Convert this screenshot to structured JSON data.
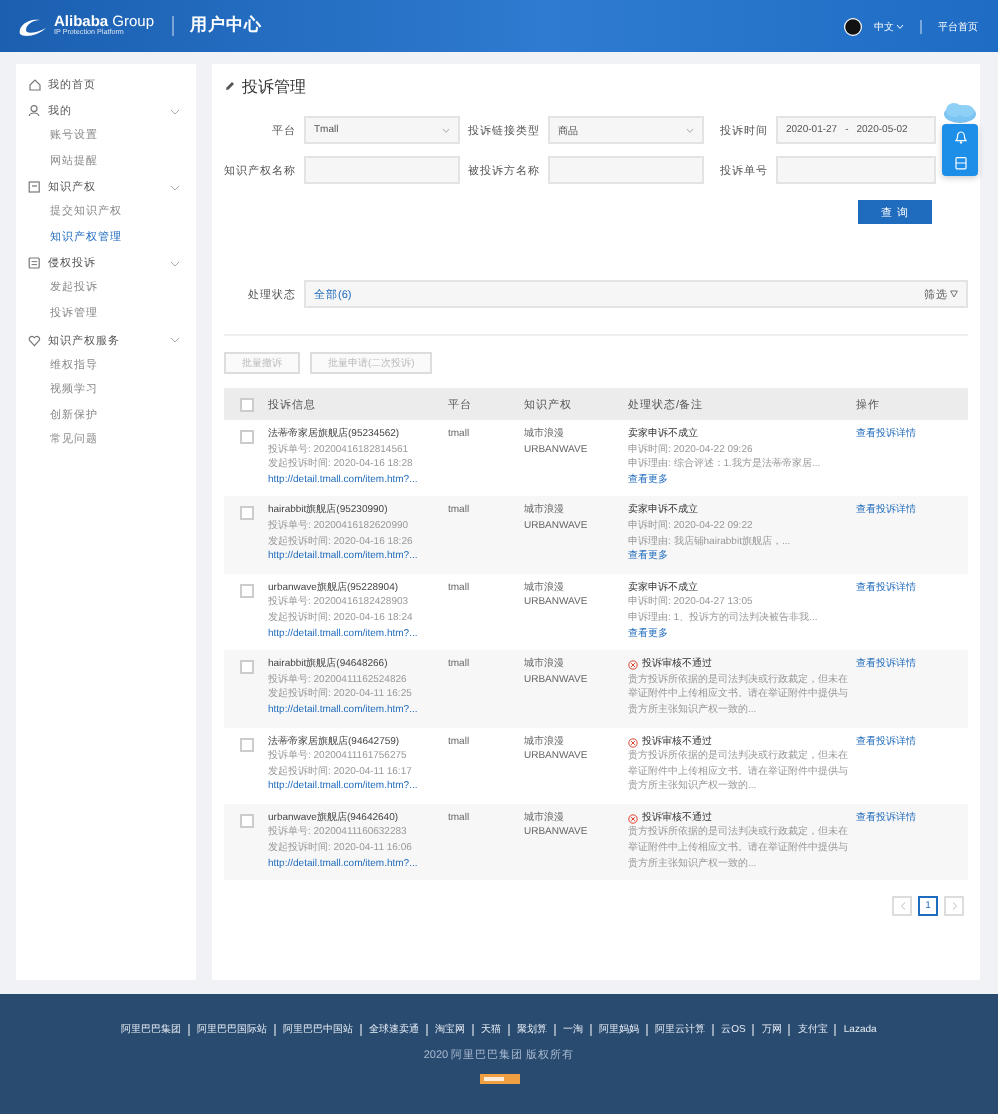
{
  "header": {
    "logo_name": "**Alibaba** Group",
    "logo_subtitle": "IP Protection Platform",
    "title": "用户中心",
    "language": "中文",
    "home_link": "平台首页"
  },
  "sidebar": {
    "items": [
      {
        "label": "我的首页",
        "kind": "link",
        "selected": false
      },
      {
        "label": "我的",
        "kind": "group",
        "expanded": true,
        "children": [
          {
            "label": "账号设置",
            "selected": false
          },
          {
            "label": "网站提醒",
            "selected": false
          }
        ]
      },
      {
        "label": "知识产权",
        "kind": "group",
        "expanded": true,
        "children": [
          {
            "label": "提交知识产权",
            "selected": false
          },
          {
            "label": "知识产权管理",
            "selected": true
          }
        ]
      },
      {
        "label": "侵权投诉",
        "kind": "group",
        "expanded": true,
        "children": [
          {
            "label": "发起投诉",
            "selected": false
          },
          {
            "label": "投诉管理",
            "selected": false
          }
        ]
      },
      {
        "label": "知识产权服务",
        "kind": "group",
        "expanded": true,
        "children": [
          {
            "label": "维权指导",
            "selected": false
          },
          {
            "label": "视频学习",
            "selected": false
          },
          {
            "label": "创新保护",
            "selected": false
          },
          {
            "label": "常见问题",
            "selected": false
          }
        ]
      }
    ]
  },
  "page_title": "投诉管理",
  "filters": [
    {
      "label": "平台",
      "kind": "select",
      "value": "Tmall"
    },
    {
      "label": "投诉链接类型",
      "kind": "select",
      "value": "商品"
    },
    {
      "label": "投诉时间",
      "kind": "daterange",
      "start": "2020-01-27",
      "separator": "-",
      "end": "2020-05-02"
    },
    {
      "label": "知识产权名称",
      "kind": "text"
    },
    {
      "label": "被投诉方名称",
      "kind": "text"
    },
    {
      "label": "投诉单号",
      "kind": "text"
    }
  ],
  "search_button": "查 询",
  "status_filter": {
    "label": "处理状态",
    "options": [
      {
        "label": "全部(6)",
        "selected": true
      }
    ],
    "filter_button": "筛选"
  },
  "bulk_actions": [
    {
      "label": "批量撤诉",
      "disabled": true
    },
    {
      "label": "批量申请(二次投诉)",
      "disabled": true
    }
  ],
  "table": {
    "all_checked": false,
    "columns": [
      "投诉信息",
      "平台",
      "知识产权",
      "处理状态/备注",
      "操作"
    ],
    "rows": [
      {
        "checked": false,
        "store": "法蒂帝家居旗舰店(95234562)",
        "complaint_no": "投诉单号: 20200416182814561",
        "filed_time": "发起投诉时间: 2020-04-16 18:28",
        "link": "http://detail.tmall.com/item.htm?...",
        "platform": "tmall",
        "ip_name": "城市浪漫",
        "ip_brand": "URBANWAVE",
        "status": {
          "kind": "appeal",
          "title": "卖家申诉不成立",
          "time": "申诉时间: 2020-04-22 09:26",
          "reason": "申诉理由: 综合评述：1.我方是法蒂帝家居...",
          "more": "查看更多"
        },
        "action": "查看投诉详情"
      },
      {
        "checked": false,
        "store": "hairabbit旗舰店(95230990)",
        "complaint_no": "投诉单号: 20200416182620990",
        "filed_time": "发起投诉时间: 2020-04-16 18:26",
        "link": "http://detail.tmall.com/item.htm?...",
        "platform": "tmall",
        "ip_name": "城市浪漫",
        "ip_brand": "URBANWAVE",
        "status": {
          "kind": "appeal",
          "title": "卖家申诉不成立",
          "time": "申诉时间: 2020-04-22 09:22",
          "reason": "申诉理由: 我店铺hairabbit旗舰店，...",
          "more": "查看更多"
        },
        "action": "查看投诉详情"
      },
      {
        "checked": false,
        "store": "urbanwave旗舰店(95228904)",
        "complaint_no": "投诉单号: 20200416182428903",
        "filed_time": "发起投诉时间: 2020-04-16 18:24",
        "link": "http://detail.tmall.com/item.htm?...",
        "platform": "tmall",
        "ip_name": "城市浪漫",
        "ip_brand": "URBANWAVE",
        "status": {
          "kind": "appeal",
          "title": "卖家申诉不成立",
          "time": "申诉时间: 2020-04-27 13:05",
          "reason": "申诉理由: 1、投诉方的司法判决被告非我...",
          "more": "查看更多"
        },
        "action": "查看投诉详情"
      },
      {
        "checked": false,
        "store": "hairabbit旗舰店(94648266)",
        "complaint_no": "投诉单号: 20200411162524826",
        "filed_time": "发起投诉时间: 2020-04-11 16:25",
        "link": "http://detail.tmall.com/item.htm?...",
        "platform": "tmall",
        "ip_name": "城市浪漫",
        "ip_brand": "URBANWAVE",
        "status": {
          "kind": "rejected",
          "title": "投诉审核不通过",
          "note": "贵方投诉所依据的是司法判决或行政裁定，但未在举证附件中上传相应文书。请在举证附件中提供与贵方所主张知识产权一致的..."
        },
        "action": "查看投诉详情"
      },
      {
        "checked": false,
        "store": "法蒂帝家居旗舰店(94642759)",
        "complaint_no": "投诉单号: 20200411161756275",
        "filed_time": "发起投诉时间: 2020-04-11 16:17",
        "link": "http://detail.tmall.com/item.htm?...",
        "platform": "tmall",
        "ip_name": "城市浪漫",
        "ip_brand": "URBANWAVE",
        "status": {
          "kind": "rejected",
          "title": "投诉审核不通过",
          "note": "贵方投诉所依据的是司法判决或行政裁定，但未在举证附件中上传相应文书。请在举证附件中提供与贵方所主张知识产权一致的..."
        },
        "action": "查看投诉详情"
      },
      {
        "checked": false,
        "store": "urbanwave旗舰店(94642640)",
        "complaint_no": "投诉单号: 20200411160632283",
        "filed_time": "发起投诉时间: 2020-04-11 16:06",
        "link": "http://detail.tmall.com/item.htm?...",
        "platform": "tmall",
        "ip_name": "城市浪漫",
        "ip_brand": "URBANWAVE",
        "status": {
          "kind": "rejected",
          "title": "投诉审核不通过",
          "note": "贵方投诉所依据的是司法判决或行政裁定，但未在举证附件中上传相应文书。请在举证附件中提供与贵方所主张知识产权一致的..."
        },
        "action": "查看投诉详情"
      }
    ]
  },
  "pagination": {
    "pages": [
      {
        "label": "1",
        "selected": true
      }
    ]
  },
  "footer": {
    "links": [
      "阿里巴巴集团",
      "阿里巴巴国际站",
      "阿里巴巴中国站",
      "全球速卖通",
      "淘宝网",
      "天猫",
      "聚划算",
      "一淘",
      "阿里妈妈",
      "阿里云计算",
      "云OS",
      "万网",
      "支付宝",
      "Lazada"
    ],
    "copyright": "2020 阿里巴巴集团 版权所有"
  }
}
